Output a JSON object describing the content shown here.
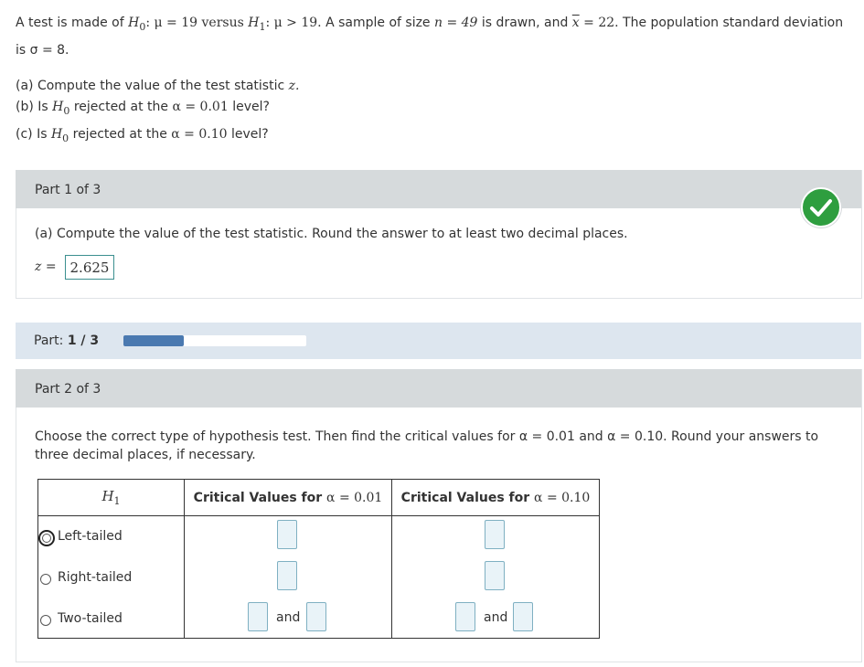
{
  "problem": {
    "intro_prefix": "A test is made of",
    "h0_symbol": "H",
    "h0_sub": "0",
    "h0_eq": ": μ = 19 versus",
    "h1_symbol": "H",
    "h1_sub": "1",
    "h1_eq": ": μ > 19.",
    "sample_text": " A sample of size ",
    "n_expr": "n = 49",
    "drawn_text": " is drawn, and ",
    "xbar": "x",
    "xbar_eq": " = 22.",
    "pop_text": " The population standard deviation",
    "line2": "is σ = 8.",
    "q_a": "(a) Compute the value of the test statistic",
    "q_a_var": "z.",
    "q_b_prefix": "(b) Is",
    "q_b_suffix": "rejected at the",
    "q_b_alpha": "α = 0.01",
    "q_b_end": "level?",
    "q_c_prefix": "(c) Is",
    "q_c_suffix": "rejected at the",
    "q_c_alpha": "α = 0.10",
    "q_c_end": "level?"
  },
  "part1": {
    "header": "Part 1 of 3",
    "instruction": "(a) Compute the value of the test statistic. Round the answer to at least two decimal places.",
    "z_label": "z =",
    "z_value": "2.625",
    "status_icon": "check-icon"
  },
  "progress": {
    "label": "Part:",
    "value": "1 / 3",
    "fraction": 0.333
  },
  "part2": {
    "header": "Part 2 of 3",
    "instruction_line1": "Choose the correct type of hypothesis test. Then find the critical values for α = 0.01 and α = 0.10. Round your answers to",
    "instruction_line2": "three decimal places, if necessary.",
    "table": {
      "col1_header_symbol": "H",
      "col1_header_sub": "1",
      "col2_header_text": "Critical Values for",
      "col2_header_alpha": "α = 0.01",
      "col3_header_text": "Critical Values for",
      "col3_header_alpha": "α = 0.10",
      "rows": [
        {
          "label": "Left-tailed",
          "selected": true
        },
        {
          "label": "Right-tailed",
          "selected": false
        },
        {
          "label": "Two-tailed",
          "selected": false
        }
      ],
      "and_label": "and"
    }
  },
  "colors": {
    "panel_header": "#d6dadc",
    "progress_panel": "#dde6ef",
    "progress_fill": "#4a79b0",
    "check_green": "#2e9e3f",
    "input_fill": "#e9f3f8"
  }
}
